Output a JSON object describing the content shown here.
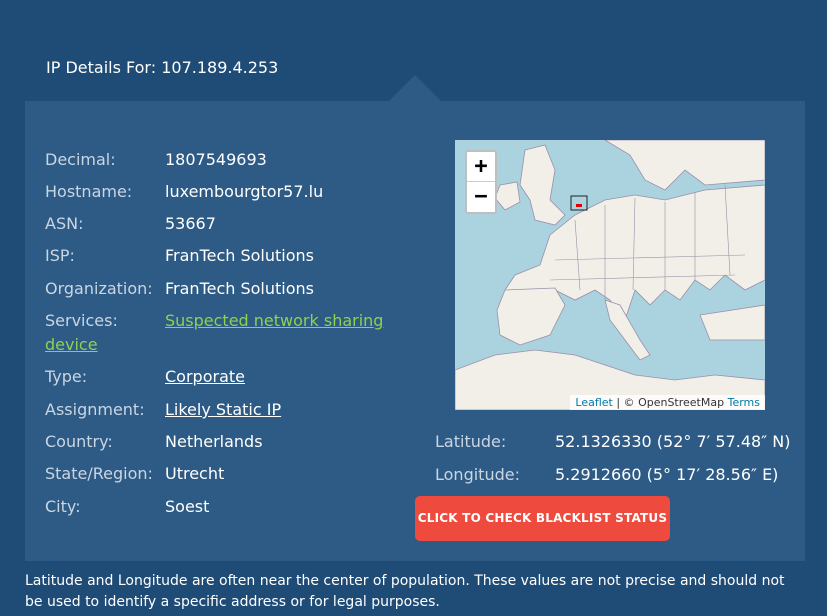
{
  "header": {
    "title": "IP Details For: 107.189.4.253"
  },
  "details": {
    "decimal": {
      "label": "Decimal:",
      "value": "1807549693"
    },
    "hostname": {
      "label": "Hostname:",
      "value": "luxembourgtor57.lu"
    },
    "asn": {
      "label": "ASN:",
      "value": "53667"
    },
    "isp": {
      "label": "ISP:",
      "value": "FranTech Solutions"
    },
    "organization": {
      "label": "Organization:",
      "value": "FranTech Solutions"
    },
    "services": {
      "label": "Services:",
      "value": "Suspected network sharing device"
    },
    "type": {
      "label": "Type:",
      "value": "Corporate"
    },
    "assignment": {
      "label": "Assignment:",
      "value": "Likely Static IP"
    },
    "country": {
      "label": "Country:",
      "value": "Netherlands"
    },
    "state": {
      "label": "State/Region:",
      "value": "Utrecht"
    },
    "city": {
      "label": "City:",
      "value": "Soest"
    }
  },
  "map": {
    "zoom_in": "+",
    "zoom_out": "−",
    "attribution_leaflet": "Leaflet",
    "attribution_sep": " | © ",
    "attribution_osm": "OpenStreetMap",
    "attribution_terms": "Terms"
  },
  "coords": {
    "latitude": {
      "label": "Latitude:",
      "value": "52.1326330  (52° 7′ 57.48″ N)"
    },
    "longitude": {
      "label": "Longitude:",
      "value": "5.2912660  (5° 17′ 28.56″ E)"
    }
  },
  "actions": {
    "blacklist_button": "CLICK TO CHECK BLACKLIST STATUS"
  },
  "footer": {
    "note": "Latitude and Longitude are often near the center of population. These values are not precise and should not be used to identify a specific address or for legal purposes."
  },
  "colors": {
    "background": "#1f4c76",
    "panel": "#2d5b85",
    "link": "#8fd14f",
    "button": "#ee4b3e"
  }
}
